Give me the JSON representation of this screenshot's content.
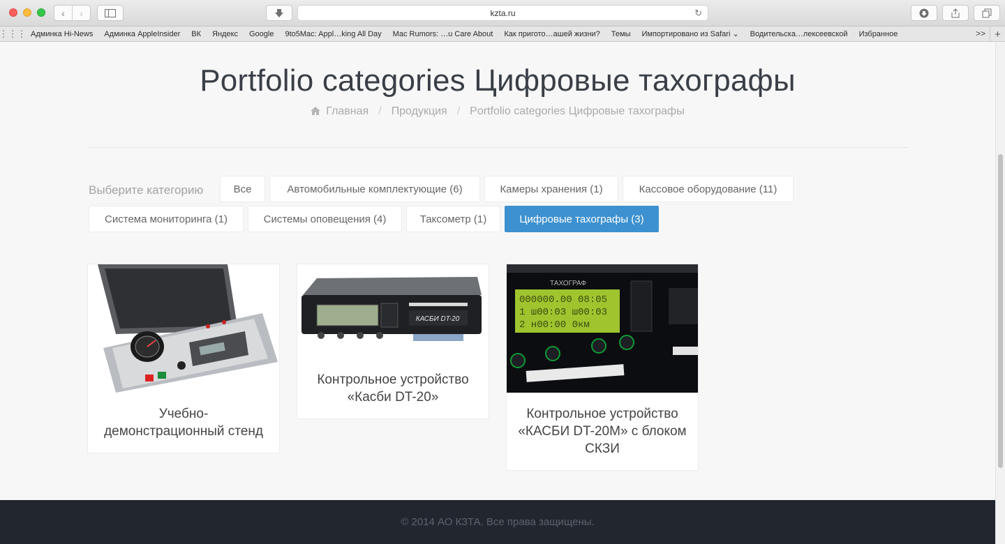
{
  "browser": {
    "url": "kzta.ru",
    "bookmarks": [
      "Админка Hi-News",
      "Админка AppleInsider",
      "ВК",
      "Яндекс",
      "Google",
      "9to5Mac: Appl…king All Day",
      "Mac Rumors: …u Care About",
      "Как пригото…ашей жизни?",
      "Темы",
      "Импортировано из Safari ⌄",
      "Водительска…лексеевской",
      "Избранное"
    ],
    "more_label": ">>"
  },
  "header": {
    "title": "Portfolio categories Цифровые тахографы",
    "breadcrumb": [
      "Главная",
      "Продукция",
      "Portfolio categories Цифровые тахографы"
    ],
    "breadcrumb_separator": "/"
  },
  "filters": {
    "label": "Выберите категорию",
    "buttons": [
      "Все",
      "Автомобильные комплектующие (6)",
      "Камеры хранения (1)",
      "Кассовое оборудование (11)",
      "Система мониторинга (1)",
      "Системы оповещения (4)",
      "Таксометр (1)",
      "Цифровые тахографы (3)"
    ],
    "active": "Цифровые тахографы (3)"
  },
  "items": [
    {
      "title": "Учебно-демонстрационный стенд",
      "image": "demo-stand-case-image"
    },
    {
      "title": "Контрольное устройство «Касби DT-20»",
      "image": "kasbi-dt20-tachograph-image",
      "image_label": "КАСБИ DT-20"
    },
    {
      "title": "Контрольное устройство «КАСБИ DT-20М» с блоком СКЗИ",
      "image": "kasbi-dt20m-display-image",
      "image_label": "ТАХОГРАФ",
      "display_lines": [
        "000000.00 08:05",
        "1 ш00:03 ш00:03",
        "2 н00:00 0км"
      ]
    }
  ],
  "footer": {
    "text": "© 2014 АО КЗТА. Все права защищены."
  },
  "colors": {
    "accent": "#3d91d0",
    "footer_bg": "#22262f",
    "page_bg": "#f7f7f7"
  }
}
